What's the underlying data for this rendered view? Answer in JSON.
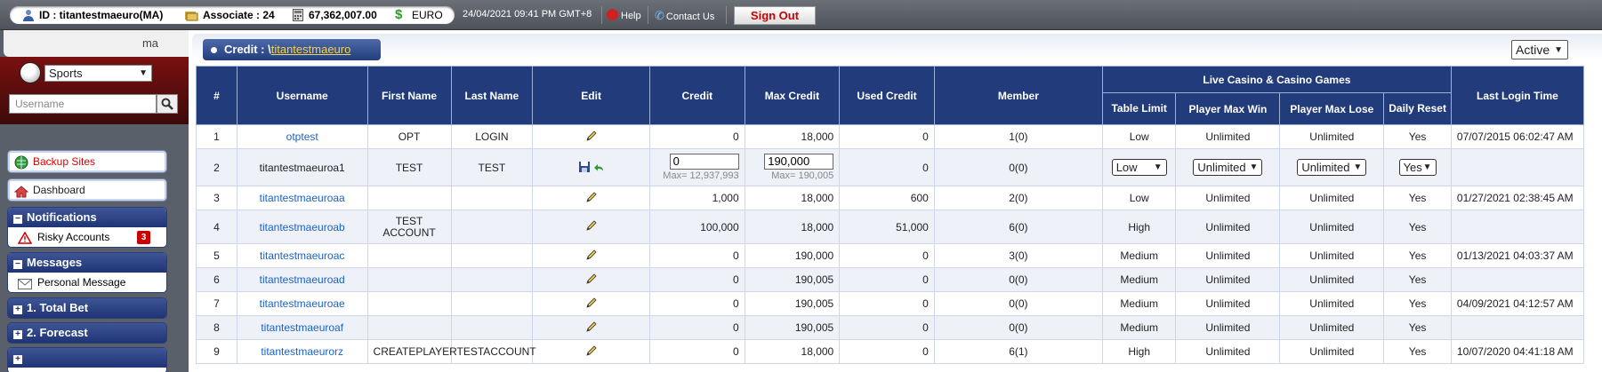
{
  "topbar": {
    "id_label": "ID : titantestmaeuro(MA)",
    "associate_label": "Associate : 24",
    "balance": "67,362,007.00",
    "currency": "EURO",
    "datetime": "24/04/2021 09:41 PM GMT+8",
    "help": "Help",
    "contact": "Contact Us",
    "signout": "Sign Out"
  },
  "sidebar": {
    "user_short": "ma",
    "sport": "Sports",
    "search_placeholder": "Username",
    "backup": "Backup Sites",
    "dashboard": "Dashboard",
    "notifications": {
      "title": "Notifications",
      "item": "Risky Accounts",
      "count": "3"
    },
    "messages": {
      "title": "Messages",
      "item": "Personal Message"
    },
    "total_bet": "1. Total Bet",
    "forecast": "2. Forecast"
  },
  "main": {
    "crumb_prefix": "Credit : \\",
    "crumb_link": "titantestmaeuro",
    "status": "Active"
  },
  "table": {
    "headers": {
      "no": "#",
      "username": "Username",
      "first": "First Name",
      "last": "Last Name",
      "edit": "Edit",
      "credit": "Credit",
      "maxcredit": "Max Credit",
      "used": "Used Credit",
      "member": "Member",
      "group": "Live Casino & Casino Games",
      "tablelimit": "Table Limit",
      "pmaxwin": "Player Max Win",
      "pmaxlose": "Player Max Lose",
      "daily": "Daily Reset",
      "lastlogin": "Last Login Time"
    },
    "rows": [
      {
        "no": "1",
        "user": "otptest",
        "first": "OPT",
        "last": "LOGIN",
        "credit": "0",
        "max": "18,000",
        "used": "0",
        "member": "1(0)",
        "limit": "Low",
        "win": "Unlimited",
        "lose": "Unlimited",
        "daily": "Yes",
        "login": "07/07/2015 06:02:47 AM"
      },
      {
        "no": "2",
        "user": "titantestmaeuroa1",
        "first": "TEST",
        "last": "TEST",
        "credit": "0",
        "credit_hint": "Max= 12,937,993",
        "max": "190,000",
        "max_hint": "Max= 190,005",
        "used": "0",
        "member": "0(0)",
        "limit": "Low",
        "win": "Unlimited",
        "lose": "Unlimited",
        "daily": "Yes",
        "login": ""
      },
      {
        "no": "3",
        "user": "titantestmaeuroaa",
        "first": "",
        "last": "",
        "credit": "1,000",
        "max": "18,000",
        "used": "600",
        "member": "2(0)",
        "limit": "Low",
        "win": "Unlimited",
        "lose": "Unlimited",
        "daily": "Yes",
        "login": "01/27/2021 02:38:45 AM"
      },
      {
        "no": "4",
        "user": "titantestmaeuroab",
        "first": "TEST ACCOUNT",
        "last": "",
        "credit": "100,000",
        "max": "18,000",
        "used": "51,000",
        "member": "6(0)",
        "limit": "High",
        "win": "Unlimited",
        "lose": "Unlimited",
        "daily": "Yes",
        "login": ""
      },
      {
        "no": "5",
        "user": "titantestmaeuroac",
        "first": "",
        "last": "",
        "credit": "0",
        "max": "190,000",
        "used": "0",
        "member": "3(0)",
        "limit": "Medium",
        "win": "Unlimited",
        "lose": "Unlimited",
        "daily": "Yes",
        "login": "01/13/2021 04:03:37 AM"
      },
      {
        "no": "6",
        "user": "titantestmaeuroad",
        "first": "",
        "last": "",
        "credit": "0",
        "max": "190,005",
        "used": "0",
        "member": "0(0)",
        "limit": "Medium",
        "win": "Unlimited",
        "lose": "Unlimited",
        "daily": "Yes",
        "login": ""
      },
      {
        "no": "7",
        "user": "titantestmaeuroae",
        "first": "",
        "last": "",
        "credit": "0",
        "max": "190,005",
        "used": "0",
        "member": "0(0)",
        "limit": "Medium",
        "win": "Unlimited",
        "lose": "Unlimited",
        "daily": "Yes",
        "login": "04/09/2021 04:12:57 AM"
      },
      {
        "no": "8",
        "user": "titantestmaeuroaf",
        "first": "",
        "last": "",
        "credit": "0",
        "max": "190,005",
        "used": "0",
        "member": "0(0)",
        "limit": "Medium",
        "win": "Unlimited",
        "lose": "Unlimited",
        "daily": "Yes",
        "login": ""
      },
      {
        "no": "9",
        "user": "titantestmaeurorz",
        "first": "CREATEPLAYER",
        "last": "TESTACCOUNT",
        "credit": "0",
        "max": "18,000",
        "used": "0",
        "member": "6(1)",
        "limit": "High",
        "win": "Unlimited",
        "lose": "Unlimited",
        "daily": "Yes",
        "login": "10/07/2020 04:41:18 AM"
      }
    ]
  }
}
